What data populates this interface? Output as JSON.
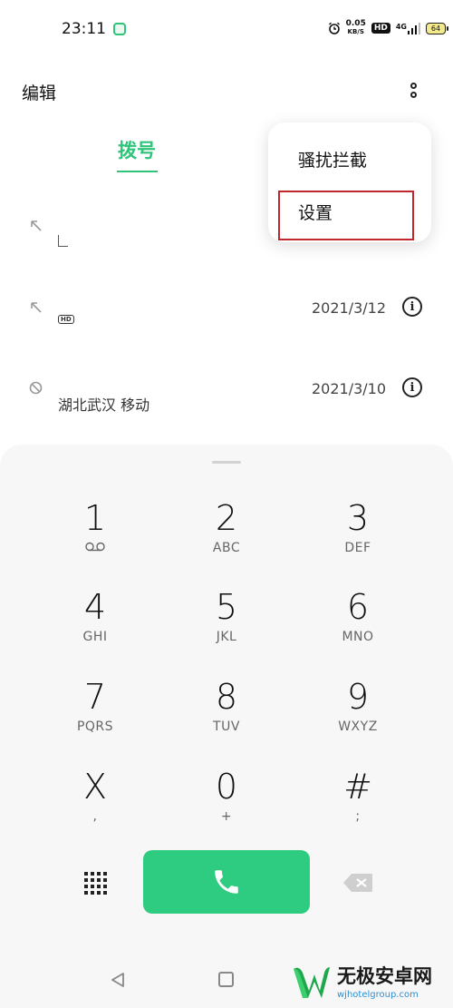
{
  "status_bar": {
    "time": "23:11",
    "net_speed_value": "0.05",
    "net_speed_unit": "KB/S",
    "hd_badge": "HD",
    "signal": "4G",
    "battery": "64"
  },
  "top_bar": {
    "edit_label": "编辑"
  },
  "tabs": {
    "dial": "拨号"
  },
  "menu": {
    "items": [
      "骚扰拦截",
      "设置"
    ]
  },
  "call_log": [
    {
      "name": "",
      "date": "",
      "location": ""
    },
    {
      "name": "",
      "date": "2021/3/12",
      "location": "",
      "badge": "HD"
    },
    {
      "name": "",
      "date": "2021/3/10",
      "location": "湖北武汉 移动"
    }
  ],
  "keypad": [
    {
      "digit": "1",
      "letters": ""
    },
    {
      "digit": "2",
      "letters": "ABC"
    },
    {
      "digit": "3",
      "letters": "DEF"
    },
    {
      "digit": "4",
      "letters": "GHI"
    },
    {
      "digit": "5",
      "letters": "JKL"
    },
    {
      "digit": "6",
      "letters": "MNO"
    },
    {
      "digit": "7",
      "letters": "PQRS"
    },
    {
      "digit": "8",
      "letters": "TUV"
    },
    {
      "digit": "9",
      "letters": "WXYZ"
    },
    {
      "digit": "X",
      "letters": ","
    },
    {
      "digit": "0",
      "letters": "+"
    },
    {
      "digit": "#",
      "letters": ";"
    }
  ],
  "watermark": {
    "name": "无极安卓网",
    "url": "wjhotelgroup.com"
  },
  "colors": {
    "accent": "#2ec47a",
    "call_button": "#2ecc80",
    "highlight": "#c0272d"
  },
  "icons": {
    "call": "phone-icon",
    "dialpad": "dialpad-icon",
    "backspace": "backspace-icon",
    "more": "more-vertical-icon",
    "info": "info-icon",
    "blocked": "blocked-icon",
    "outgoing": "outgoing-call-icon",
    "voicemail": "voicemail-icon"
  }
}
